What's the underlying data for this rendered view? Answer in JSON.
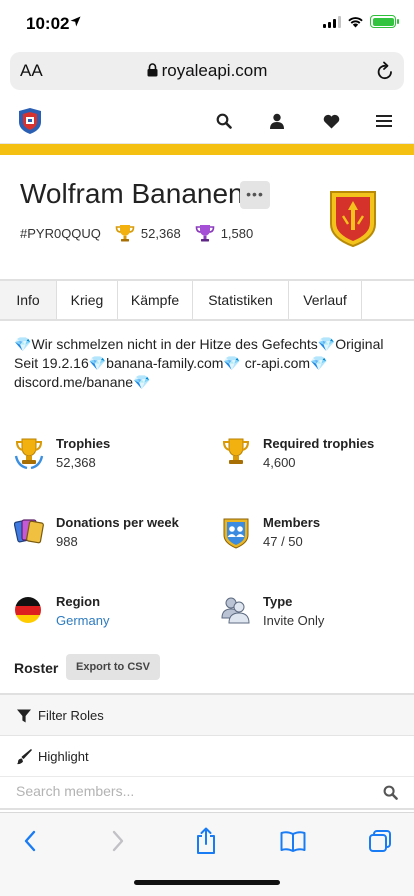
{
  "status_bar": {
    "time": "10:02"
  },
  "browser": {
    "aa_label": "AA",
    "url": "royaleapi.com"
  },
  "clan": {
    "name": "Wolfram Bananen",
    "more_label": "•••",
    "tag": "#PYR0QQUQ",
    "trophies": "52,368",
    "war_trophies": "1,580"
  },
  "tabs": [
    {
      "label": "Info",
      "active": true
    },
    {
      "label": "Krieg"
    },
    {
      "label": "Kämpfe"
    },
    {
      "label": "Statistiken"
    },
    {
      "label": "Verlauf"
    }
  ],
  "description": {
    "part1": "Wir schmelzen nicht in der Hitze des Gefechts",
    "part2": "Original Seit 19.2.16",
    "part3": "banana-family.com",
    "part4": "cr-api.com",
    "part5": "discord.me/banane",
    "gem": "💎"
  },
  "stats": {
    "trophies": {
      "label": "Trophies",
      "value": "52,368"
    },
    "required": {
      "label": "Required trophies",
      "value": "4,600"
    },
    "donations": {
      "label": "Donations per week",
      "value": "988"
    },
    "members": {
      "label": "Members",
      "value": "47 / 50"
    },
    "region": {
      "label": "Region",
      "value": "Germany"
    },
    "type": {
      "label": "Type",
      "value": "Invite Only"
    }
  },
  "roster": {
    "title": "Roster",
    "export_label": "Export to CSV",
    "filter_label": "Filter Roles",
    "highlight_label": "Highlight",
    "search_placeholder": "Search members..."
  },
  "colors": {
    "accent_yellow": "#f4c113",
    "link_blue": "#2f7bbf",
    "safari_blue": "#1a7cf5"
  }
}
